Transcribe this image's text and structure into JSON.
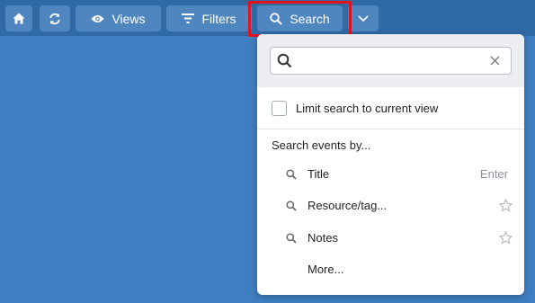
{
  "toolbar": {
    "views_label": "Views",
    "filters_label": "Filters",
    "search_label": "Search"
  },
  "search_panel": {
    "input_value": "",
    "input_placeholder": "",
    "limit_label": "Limit search to current view",
    "limit_checked": false,
    "section_title": "Search events by...",
    "items": [
      {
        "label": "Title",
        "hint": "Enter",
        "icon": "search-icon",
        "star": false
      },
      {
        "label": "Resource/tag...",
        "hint": "",
        "icon": "search-icon",
        "star": true
      },
      {
        "label": "Notes",
        "hint": "",
        "icon": "search-icon",
        "star": true
      }
    ],
    "more_label": "More..."
  },
  "colors": {
    "background": "#3f7ec0",
    "topbar": "#2f6aa6",
    "button": "#4f86bf",
    "highlight": "#e4121c"
  }
}
